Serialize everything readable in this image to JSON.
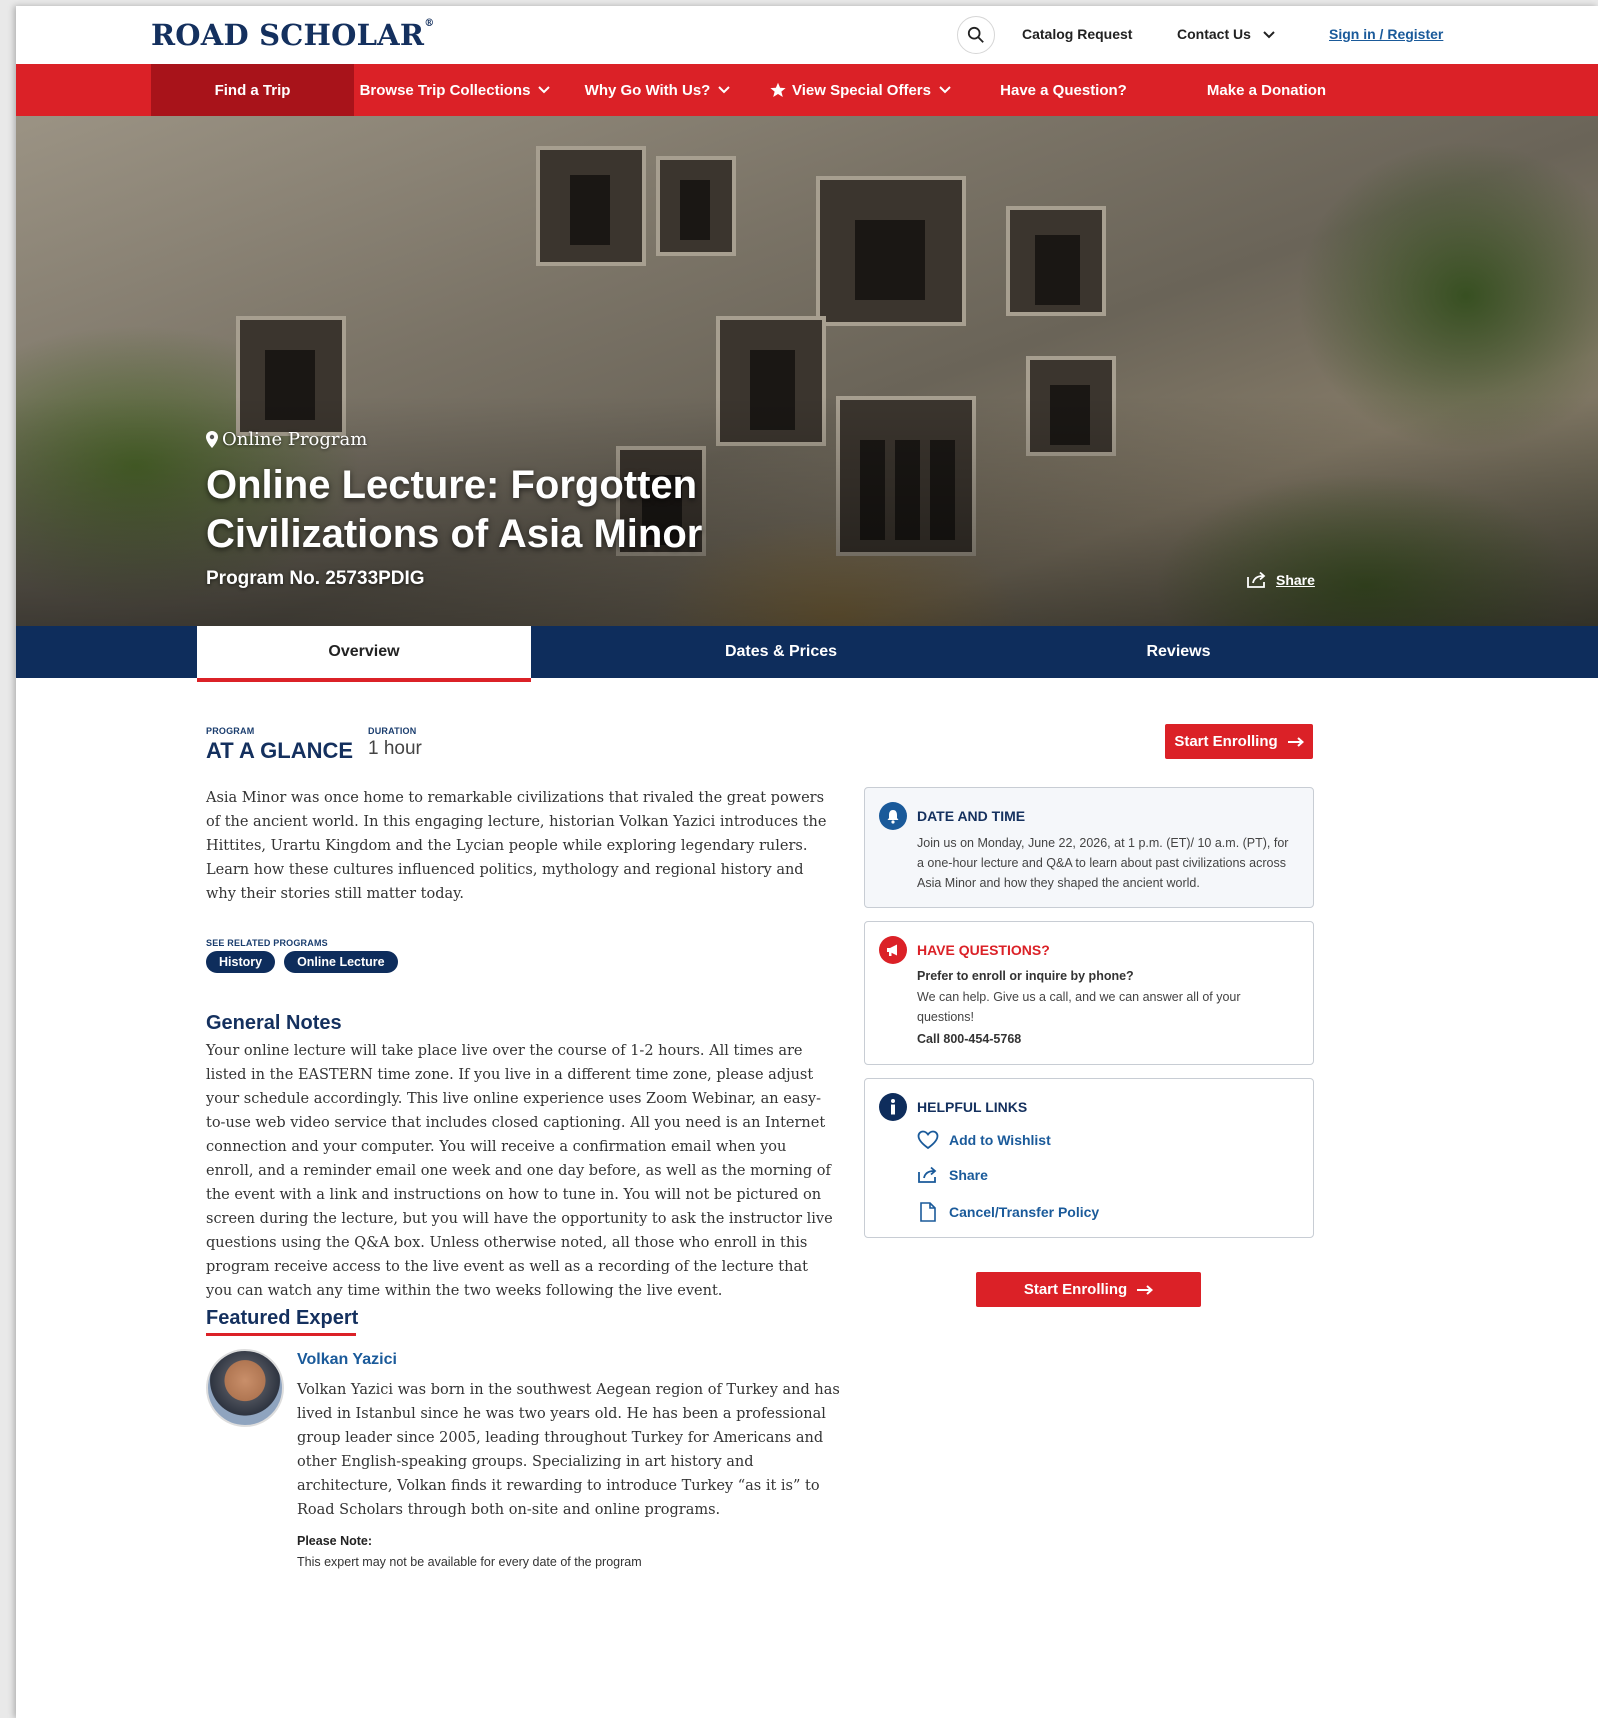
{
  "header": {
    "logo": "ROAD SCHOLAR",
    "logo_mark": "®",
    "catalog_request": "Catalog Request",
    "contact_us": "Contact Us",
    "sign_in": "Sign in / Register"
  },
  "nav": {
    "items": [
      {
        "label": "Find a Trip"
      },
      {
        "label": "Browse Trip Collections"
      },
      {
        "label": "Why Go With Us?"
      },
      {
        "label": "View Special Offers"
      },
      {
        "label": "Have a Question?"
      },
      {
        "label": "Make a Donation"
      }
    ]
  },
  "hero": {
    "location": "Online Program",
    "title": "Online Lecture: Forgotten Civilizations of Asia Minor",
    "program_no": "Program No. 25733PDIG",
    "share": "Share"
  },
  "tabs": [
    {
      "label": "Overview"
    },
    {
      "label": "Dates & Prices"
    },
    {
      "label": "Reviews"
    }
  ],
  "glance": {
    "program_label": "PROGRAM",
    "title": "AT A GLANCE",
    "duration_label": "DURATION",
    "duration": "1 hour"
  },
  "intro": "Asia Minor was once home to remarkable civilizations that rivaled the great powers of the ancient world. In this engaging lecture, historian Volkan Yazici introduces the Hittites, Urartu Kingdom and the Lycian people while exploring legendary rulers. Learn how these cultures influenced politics, mythology and regional history and why their stories still matter today.",
  "related": {
    "label": "SEE RELATED PROGRAMS",
    "tags": [
      "History",
      "Online Lecture"
    ]
  },
  "general_notes": {
    "title": "General Notes",
    "text": "Your online lecture will take place live over the course of 1-2 hours. All times are listed in the EASTERN time zone. If you live in a different time zone, please adjust your schedule accordingly. This live online experience uses Zoom Webinar, an easy-to-use web video service that includes closed captioning. All you need is an Internet connection and your computer. You will receive a confirmation email when you enroll, and a reminder email one week and one day before, as well as the morning of the event with a link and instructions on how to tune in. You will not be pictured on screen during the lecture, but you will have the opportunity to ask the instructor live questions using the Q&A box. Unless otherwise noted, all those who enroll in this program receive access to the live event as well as a recording of the lecture that you can watch any time within the two weeks following the live event."
  },
  "featured_expert": {
    "title": "Featured Expert",
    "name": "Volkan Yazici",
    "bio": "Volkan Yazici was born in the southwest Aegean region of Turkey and has lived in Istanbul since he was two years old. He has been a professional group leader since 2005, leading throughout Turkey for Americans and other English-speaking groups. Specializing in art history and architecture, Volkan finds it rewarding to introduce Turkey “as it is” to Road Scholars through both on-site and online programs.",
    "note_label": "Please Note:",
    "note_text": "This expert may not be available for every date of the program"
  },
  "sidebar": {
    "enroll_label": "Start Enrolling",
    "date_time": {
      "title": "DATE AND TIME",
      "text": "Join us on Monday, June 22, 2026, at 1 p.m. (ET)/ 10 a.m. (PT), for a one-hour lecture and Q&A to learn about past civilizations across Asia Minor and how they shaped the ancient world."
    },
    "questions": {
      "title": "HAVE QUESTIONS?",
      "subtitle": "Prefer to enroll or inquire by phone?",
      "text": "We can help. Give us a call, and we can answer all of your questions!",
      "phone": "Call 800-454-5768"
    },
    "links": {
      "title": "HELPFUL LINKS",
      "wishlist": "Add to Wishlist",
      "share": "Share",
      "policy": "Cancel/Transfer Policy"
    }
  },
  "colors": {
    "brand_red": "#db2127",
    "navy": "#0e2d5c",
    "link_blue": "#1a5a9a"
  }
}
